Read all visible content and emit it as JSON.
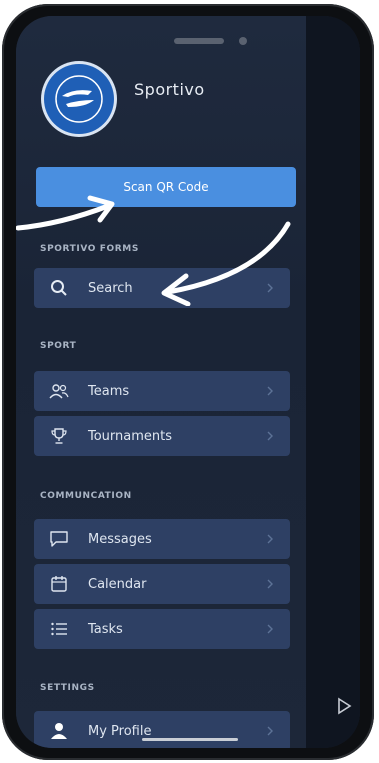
{
  "app": {
    "name": "Sportivo"
  },
  "scan_button": {
    "label": "Scan QR Code"
  },
  "sections": [
    {
      "title": "SPORTIVO FORMS",
      "items": [
        {
          "label": "Search",
          "icon": "search-icon"
        }
      ]
    },
    {
      "title": "SPORT",
      "items": [
        {
          "label": "Teams",
          "icon": "users-icon"
        },
        {
          "label": "Tournaments",
          "icon": "trophy-icon"
        }
      ]
    },
    {
      "title": "COMMUNCATION",
      "items": [
        {
          "label": "Messages",
          "icon": "message-icon"
        },
        {
          "label": "Calendar",
          "icon": "calendar-icon"
        },
        {
          "label": "Tasks",
          "icon": "tasks-icon"
        }
      ]
    },
    {
      "title": "SETTINGS",
      "items": [
        {
          "label": "My Profile",
          "icon": "profile-icon"
        }
      ]
    }
  ],
  "colors": {
    "drawer_bg": "#1f2a3e",
    "item_bg": "#2e4064",
    "accent": "#4a8fe0",
    "logo_bg": "#1f5fb6"
  }
}
